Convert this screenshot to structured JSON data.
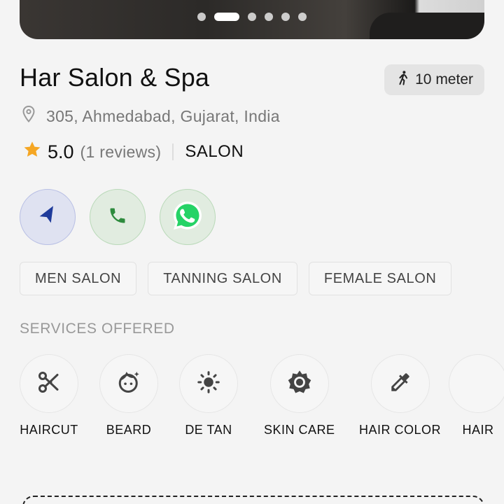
{
  "carousel": {
    "dots": 6,
    "active_index": 1
  },
  "salon": {
    "name": "Har Salon & Spa",
    "distance": "10 meter",
    "address": "305, Ahmedabad, Gujarat, India",
    "rating": "5.0",
    "reviews": "(1 reviews)",
    "category": "SALON"
  },
  "actions": [
    {
      "name": "directions",
      "icon": "navigation-arrow-icon",
      "color": "#1f3b9b"
    },
    {
      "name": "call",
      "icon": "phone-icon",
      "color": "#2e8b3e"
    },
    {
      "name": "whatsapp",
      "icon": "whatsapp-icon",
      "color": "#25d366"
    }
  ],
  "tags": [
    "MEN SALON",
    "TANNING SALON",
    "FEMALE SALON"
  ],
  "services_title": "SERVICES OFFERED",
  "services": [
    {
      "label": "HAIRCUT",
      "icon": "scissors-icon"
    },
    {
      "label": "BEARD",
      "icon": "face-icon"
    },
    {
      "label": "DE TAN",
      "icon": "sun-icon"
    },
    {
      "label": "SKIN CARE",
      "icon": "sun-gear-icon"
    },
    {
      "label": "HAIR COLOR",
      "icon": "dropper-icon"
    },
    {
      "label": "HAIR",
      "icon": "partial-icon"
    }
  ],
  "colors": {
    "star": "#f5a623",
    "background": "#f4f4f4"
  }
}
